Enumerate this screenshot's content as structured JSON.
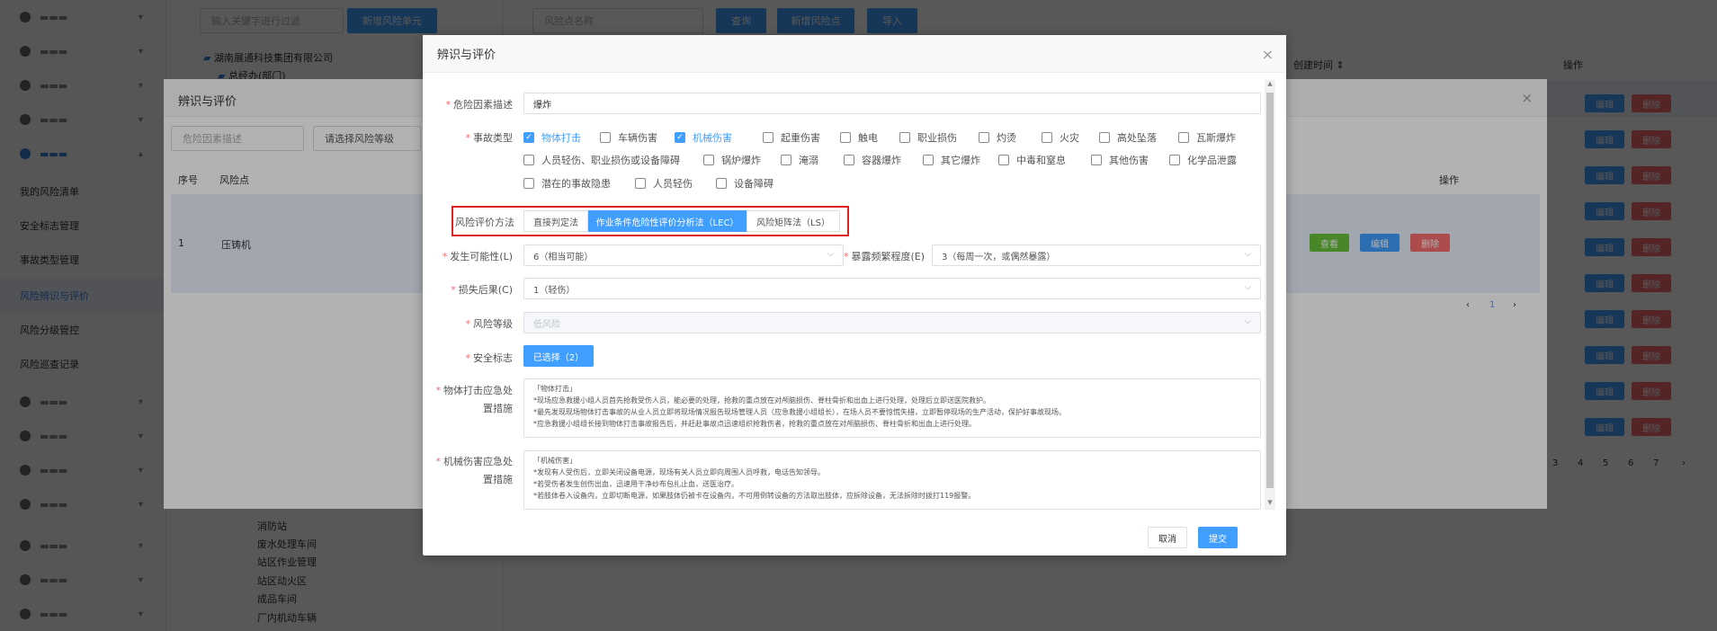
{
  "sidebar": {
    "items": [
      {
        "label": "我的风险清单"
      },
      {
        "label": "安全标志管理"
      },
      {
        "label": "事故类型管理"
      },
      {
        "label": "风险辨识与评价"
      },
      {
        "label": "风险分级管控"
      },
      {
        "label": "风险巡查记录"
      }
    ]
  },
  "left_panel": {
    "filter_placeholder": "输入关键字进行过滤",
    "add_unit_button": "新增风险单元",
    "tree_root": "湖南展通科技集团有限公司",
    "tree_child": "总经办(部门)",
    "tree_items": [
      "消防站",
      "废水处理车间",
      "站区作业管理",
      "站区动火区",
      "成品车间",
      "厂内机动车辆"
    ]
  },
  "right_panel": {
    "search_placeholder": "风险点名称",
    "query_button": "查询",
    "add_point_button": "新增风险点",
    "import_button": "导入",
    "col_create_time": "创建时间 ⇕",
    "col_ops": "操作",
    "row_actions": {
      "view": "查看",
      "edit": "编辑",
      "delete": "删除"
    },
    "pagination": [
      "3",
      "4",
      "5",
      "6",
      "7"
    ]
  },
  "dialog2": {
    "title": "辨识与评价",
    "factor_placeholder": "危险因素描述",
    "level_select": "请选择风险等级",
    "col_no": "序号",
    "col_point": "风险点",
    "col_ops": "操作",
    "row": {
      "no": "1",
      "point": "压铸机"
    },
    "actions": {
      "view": "查看",
      "edit": "编辑",
      "delete": "删除"
    },
    "page": "1"
  },
  "dialog": {
    "title": "辨识与评价",
    "hazard_label": "危险因素描述",
    "hazard_value": "爆炸",
    "accident_type_label": "事故类型",
    "accident_types": [
      {
        "label": "物体打击",
        "checked": true
      },
      {
        "label": "车辆伤害",
        "checked": false
      },
      {
        "label": "机械伤害",
        "checked": true
      },
      {
        "label": "起重伤害",
        "checked": false
      },
      {
        "label": "触电",
        "checked": false
      },
      {
        "label": "职业损伤",
        "checked": false
      },
      {
        "label": "灼烫",
        "checked": false
      },
      {
        "label": "火灾",
        "checked": false
      },
      {
        "label": "高处坠落",
        "checked": false
      },
      {
        "label": "瓦斯爆炸",
        "checked": false
      },
      {
        "label": "人员轻伤、职业损伤或设备障碍",
        "checked": false
      },
      {
        "label": "锅炉爆炸",
        "checked": false
      },
      {
        "label": "淹溺",
        "checked": false
      },
      {
        "label": "容器爆炸",
        "checked": false
      },
      {
        "label": "其它爆炸",
        "checked": false
      },
      {
        "label": "中毒和窒息",
        "checked": false
      },
      {
        "label": "其他伤害",
        "checked": false
      },
      {
        "label": "化学品泄露",
        "checked": false
      },
      {
        "label": "潜在的事故隐患",
        "checked": false
      },
      {
        "label": "人员轻伤",
        "checked": false
      },
      {
        "label": "设备障碍",
        "checked": false
      }
    ],
    "method_label": "风险评价方法",
    "methods": [
      {
        "label": "直接判定法",
        "active": false
      },
      {
        "label": "作业条件危险性评价分析法（LEC）",
        "active": true
      },
      {
        "label": "风险矩阵法（LS）",
        "active": false
      }
    ],
    "likelihood_label": "发生可能性(L)",
    "likelihood_value": "6（相当可能）",
    "exposure_label": "暴露频繁程度(E)",
    "exposure_value": "3（每周一次，或偶然暴露）",
    "consequence_label": "损失后果(C)",
    "consequence_value": "1（轻伤）",
    "level_label": "风险等级",
    "level_value": "低风险",
    "sign_label": "安全标志",
    "sign_button": "已选择（2）",
    "strike_label_1": "物体打击应急处",
    "strike_label_2": "置措施",
    "strike_text": "「物体打击」\n*现场应急救援小组人员首先抢救受伤人员，能必要的处理，抢救的重点放在对颅脑损伤、脊柱骨折和出血上进行处理，处理后立即送医院救护。\n*最先发现现场物体打击事故的从业人员立即将现场情况报告现场管理人员（应急救援小组组长），在场人员不要惊慌失措，立即暂停现场的生产活动，保护好事故现场。\n*应急救援小组组长接到物体打击事故报告后，并赶赴事故点迅速组织抢救伤者，抢救的重点放在对颅脑损伤、脊柱骨折和出血上进行处理。",
    "mech_label_1": "机械伤害应急处",
    "mech_label_2": "置措施",
    "mech_text": "「机械伤害」\n*发现有人受伤后，立即关闭设备电源，现场有关人员立即向周围人员呼救，电话告知领导。\n*若受伤者发生创伤出血，迅速用干净纱布包扎止血，送医治疗。\n*若肢体卷入设备内，立即切断电源，如果肢体仍被卡在设备内，不可用倒转设备的方法取出肢体，应拆除设备，无法拆除时拨打119报警。",
    "cancel_button": "取消",
    "submit_button": "提交"
  }
}
